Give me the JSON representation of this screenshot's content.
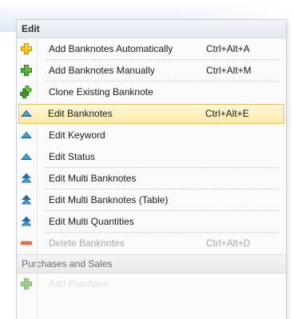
{
  "menu": {
    "header": "Edit",
    "items": [
      {
        "label": "Add Banknotes Automatically",
        "shortcut": "Ctrl+Alt+A",
        "icon": "plus-yellow-icon"
      },
      {
        "label": "Add Banknotes Manually",
        "shortcut": "Ctrl+Alt+M",
        "icon": "plus-green-icon"
      },
      {
        "label": "Clone Existing Banknote",
        "shortcut": "",
        "icon": "clone-plus-icon"
      },
      {
        "label": "Edit Banknotes",
        "shortcut": "Ctrl+Alt+E",
        "icon": "edit-triangle-icon"
      },
      {
        "label": "Edit Keyword",
        "shortcut": "",
        "icon": "edit-triangle-icon"
      },
      {
        "label": "Edit Status",
        "shortcut": "",
        "icon": "edit-triangle-icon"
      },
      {
        "label": "Edit Multi Banknotes",
        "shortcut": "",
        "icon": "edit-multi-icon"
      },
      {
        "label": "Edit Multi Banknotes (Table)",
        "shortcut": "",
        "icon": "edit-multi-icon"
      },
      {
        "label": "Edit Multi Quantities",
        "shortcut": "",
        "icon": "edit-multi-icon"
      },
      {
        "label": "Delete Banknotes",
        "shortcut": "Ctrl+Alt+D",
        "icon": "minus-icon"
      }
    ],
    "section2_header": "Purchases and Sales",
    "section2_items": [
      {
        "label": "Add Purchase",
        "icon": "plus-green-icon"
      }
    ],
    "colors": {
      "highlight_bg": "#ffe9a6",
      "highlight_border": "#e5c365",
      "edit_icon": "#1f6fb0",
      "delete_icon": "#e8743b",
      "add_green": "#3aa43a",
      "add_yellow": "#f0b400"
    }
  }
}
